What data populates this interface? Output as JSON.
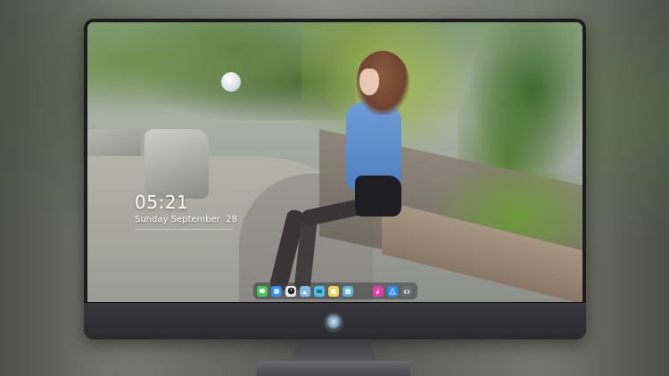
{
  "lockscreen": {
    "time": "05:21",
    "date": "Sunday September  28"
  },
  "dock": {
    "icons": [
      {
        "name": "messages-icon",
        "color": "#3fc94f"
      },
      {
        "name": "finder-icon",
        "color": "#2f8ff0"
      },
      {
        "name": "clock-icon",
        "color": "#e8e8e8"
      },
      {
        "name": "photos-icon",
        "color": "#7fb7e6"
      },
      {
        "name": "video-icon",
        "color": "#46c2e8"
      },
      {
        "name": "notes-icon",
        "color": "#f7d24b"
      },
      {
        "name": "gallery-icon",
        "color": "#5db0d8"
      },
      {
        "name": "music-icon",
        "color": "#e53ba8"
      },
      {
        "name": "app-store-icon",
        "color": "#2d8cf0"
      },
      {
        "name": "camera-icon",
        "color": "#6b6e73"
      }
    ]
  },
  "monitor": {
    "logo": "monitor-logo"
  }
}
